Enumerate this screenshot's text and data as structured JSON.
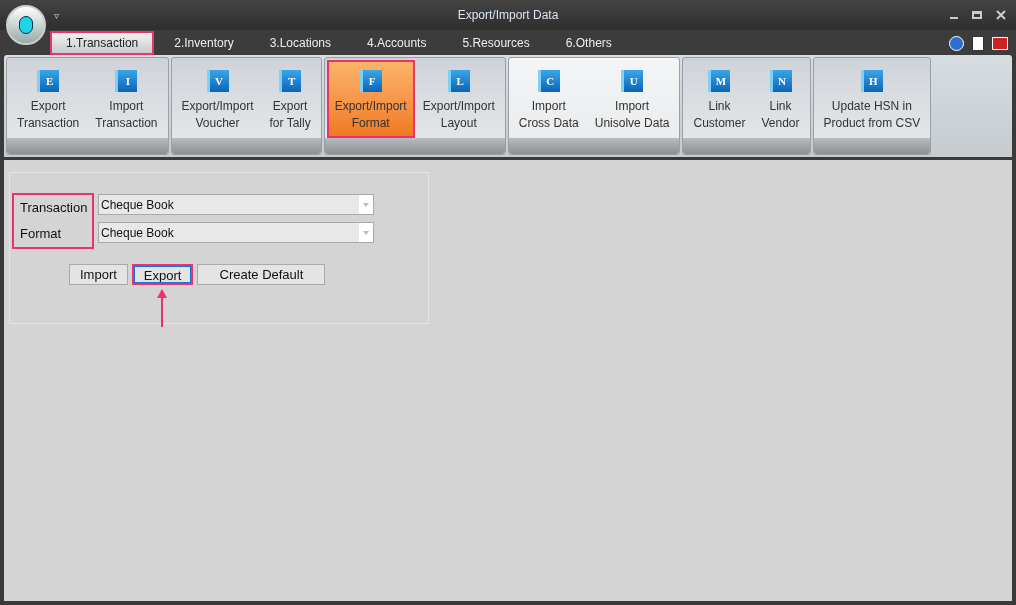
{
  "window": {
    "title": "Export/Import Data",
    "quick_access": "▿"
  },
  "tabs": [
    {
      "label": "1.Transaction",
      "selected": true
    },
    {
      "label": "2.Inventory",
      "selected": false
    },
    {
      "label": "3.Locations",
      "selected": false
    },
    {
      "label": "4.Accounts",
      "selected": false
    },
    {
      "label": "5.Resources",
      "selected": false
    },
    {
      "label": "6.Others",
      "selected": false
    }
  ],
  "ribbon_groups": [
    {
      "highlighted": false,
      "buttons": [
        {
          "icon_letter": "E",
          "label": "Export\nTransaction",
          "selected": false
        },
        {
          "icon_letter": "I",
          "label": "Import\nTransaction",
          "selected": false
        }
      ]
    },
    {
      "highlighted": false,
      "buttons": [
        {
          "icon_letter": "V",
          "label": "Export/Import\nVoucher",
          "selected": false
        },
        {
          "icon_letter": "T",
          "label": "Export\nfor Tally",
          "selected": false
        }
      ]
    },
    {
      "highlighted": false,
      "buttons": [
        {
          "icon_letter": "F",
          "label": "Export/Import\nFormat",
          "selected": true
        },
        {
          "icon_letter": "L",
          "label": "Export/Import\nLayout",
          "selected": false
        }
      ]
    },
    {
      "highlighted": true,
      "buttons": [
        {
          "icon_letter": "C",
          "label": "Import\nCross Data",
          "selected": false
        },
        {
          "icon_letter": "U",
          "label": "Import\nUnisolve Data",
          "selected": false
        }
      ]
    },
    {
      "highlighted": false,
      "buttons": [
        {
          "icon_letter": "M",
          "label": "Link\nCustomer",
          "selected": false
        },
        {
          "icon_letter": "N",
          "label": "Link\nVendor",
          "selected": false
        }
      ]
    },
    {
      "highlighted": false,
      "buttons": [
        {
          "icon_letter": "H",
          "label": "Update HSN in\nProduct from CSV",
          "selected": false
        }
      ]
    }
  ],
  "form": {
    "fields": [
      {
        "label": "Transaction",
        "value": "Cheque Book"
      },
      {
        "label": "Format",
        "value": "Cheque Book"
      }
    ],
    "buttons": [
      {
        "label": "Import",
        "focused": false
      },
      {
        "label": "Export",
        "focused": true
      },
      {
        "label": "Create Default",
        "focused": false
      }
    ]
  }
}
